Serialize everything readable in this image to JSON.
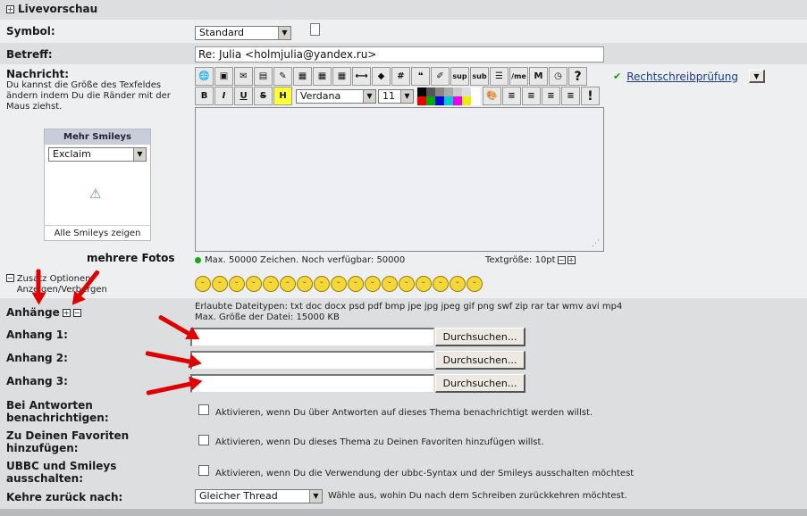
{
  "preview": {
    "label": "Livevorschau"
  },
  "symbol": {
    "label": "Symbol:",
    "value": "Standard"
  },
  "subject": {
    "label": "Betreff:",
    "value": "Re: Julia <holmjulia@yandex.ru>"
  },
  "message": {
    "label": "Nachricht:",
    "hint": "Du kannst die Größe des Texfeldes ändern indem Du die Ränder mit der Maus ziehst.",
    "font": "Verdana",
    "size": "11",
    "spellcheck": "Rechtschreibprüfung",
    "counter": "Max. 50000 Zeichen. Noch verfügbar:  50000",
    "textsize": "Textgröße: 10pt"
  },
  "smileys_box": {
    "title": "Mehr Smileys",
    "selected": "Exclaim",
    "show_all": "Alle Smileys zeigen"
  },
  "annotation": {
    "text": "mehrere Fotos"
  },
  "options": {
    "label": "Zusatz Optionen Anzeigen/Verbergen"
  },
  "attachments": {
    "label": "Anhänge",
    "allowed": "Erlaubte Dateitypen: txt doc docx psd pdf bmp jpe jpg jpeg gif png swf zip rar tar wmv avi mp4",
    "maxsize": "Max. Größe der Datei: 15000 KB",
    "items": [
      {
        "label": "Anhang 1:",
        "button": "Durchsuchen..."
      },
      {
        "label": "Anhang 2:",
        "button": "Durchsuchen..."
      },
      {
        "label": "Anhang 3:",
        "button": "Durchsuchen..."
      }
    ]
  },
  "notify": {
    "label1": "Bei Antworten",
    "label2": "benachrichtigen:",
    "text": "Aktivieren, wenn Du über Antworten auf dieses Thema benachrichtigt werden willst."
  },
  "favorites": {
    "label1": "Zu Deinen Favoriten",
    "label2": "hinzufügen:",
    "text": "Aktivieren, wenn Du dieses Thema zu Deinen Favoriten hinzufügen willst."
  },
  "ubbc": {
    "label1": "UBBC und Smileys",
    "label2": "ausschalten:",
    "text": "Aktivieren, wenn Du die Verwendung der ubbc-Syntax und der Smileys ausschalten möchtest"
  },
  "return": {
    "label": "Kehre zurück nach:",
    "value": "Gleicher Thread",
    "text": "Wähle aus, wohin Du nach dem Schreiben zurückkehren möchtest."
  },
  "colors": {
    "annotation_arrow": "#e00000",
    "link": "#1a3a8a"
  }
}
